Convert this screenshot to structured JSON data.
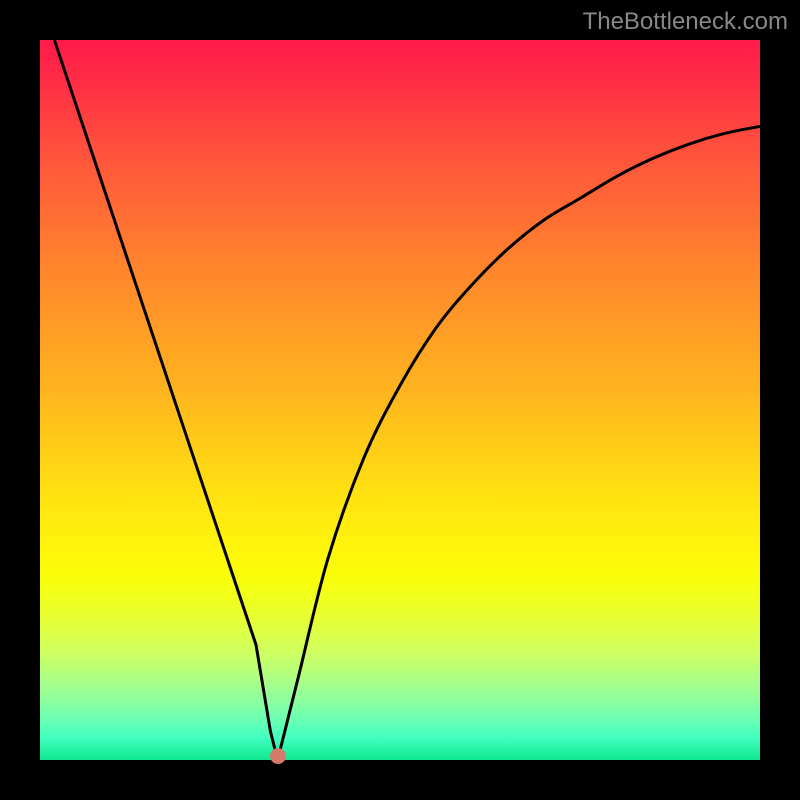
{
  "watermark": "TheBottleneck.com",
  "chart_data": {
    "type": "line",
    "title": "",
    "xlabel": "",
    "ylabel": "",
    "xlim": [
      0,
      100
    ],
    "ylim": [
      0,
      100
    ],
    "series": [
      {
        "name": "curve",
        "x": [
          2,
          8,
          14,
          20,
          24,
          28,
          30,
          31,
          32,
          33,
          34,
          36,
          40,
          45,
          50,
          55,
          60,
          65,
          70,
          75,
          80,
          85,
          90,
          95,
          100
        ],
        "y": [
          100,
          82,
          64,
          46,
          34,
          22,
          16,
          10,
          4,
          0,
          4,
          12,
          28,
          42,
          52,
          60,
          66,
          71,
          75,
          78,
          81,
          83.5,
          85.5,
          87,
          88
        ]
      }
    ],
    "marker": {
      "x": 33,
      "y": 0.5
    },
    "background": "red-to-green-gradient"
  }
}
